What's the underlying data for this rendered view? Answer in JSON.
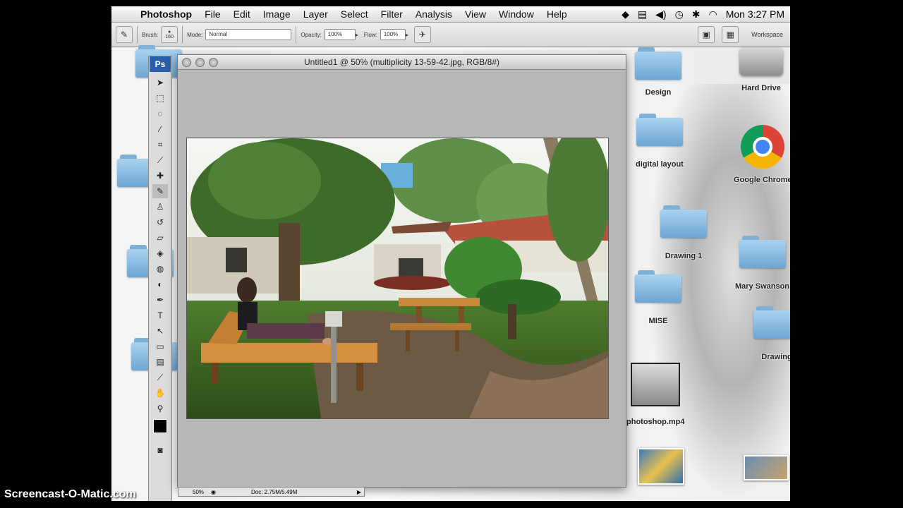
{
  "menubar": {
    "app_name": "Photoshop",
    "items": [
      "File",
      "Edit",
      "Image",
      "Layer",
      "Select",
      "Filter",
      "Analysis",
      "View",
      "Window",
      "Help"
    ],
    "clock": "Mon 3:27 PM"
  },
  "options_bar": {
    "brush_label": "Brush:",
    "brush_size": "160",
    "mode_label": "Mode:",
    "mode_value": "Normal",
    "opacity_label": "Opacity:",
    "opacity_value": "100%",
    "flow_label": "Flow:",
    "flow_value": "100%",
    "workspace_label": "Workspace"
  },
  "tools": {
    "logo": "Ps"
  },
  "document": {
    "title": "Untitled1 @ 50% (multiplicity 13-59-42.jpg, RGB/8#)",
    "zoom": "50%",
    "doc_size": "Doc: 2.75M/5.49M"
  },
  "desktop": {
    "icons": [
      {
        "label": "Design"
      },
      {
        "label": "Hard Drive"
      },
      {
        "label": "digital layout"
      },
      {
        "label": "Google Chrome"
      },
      {
        "label": "Drawing 1"
      },
      {
        "label": "Mary Swanson"
      },
      {
        "label": "MISE"
      },
      {
        "label": "Drawing"
      },
      {
        "label": "photoshop.mp4"
      }
    ]
  },
  "watermark": "Screencast-O-Matic.com"
}
